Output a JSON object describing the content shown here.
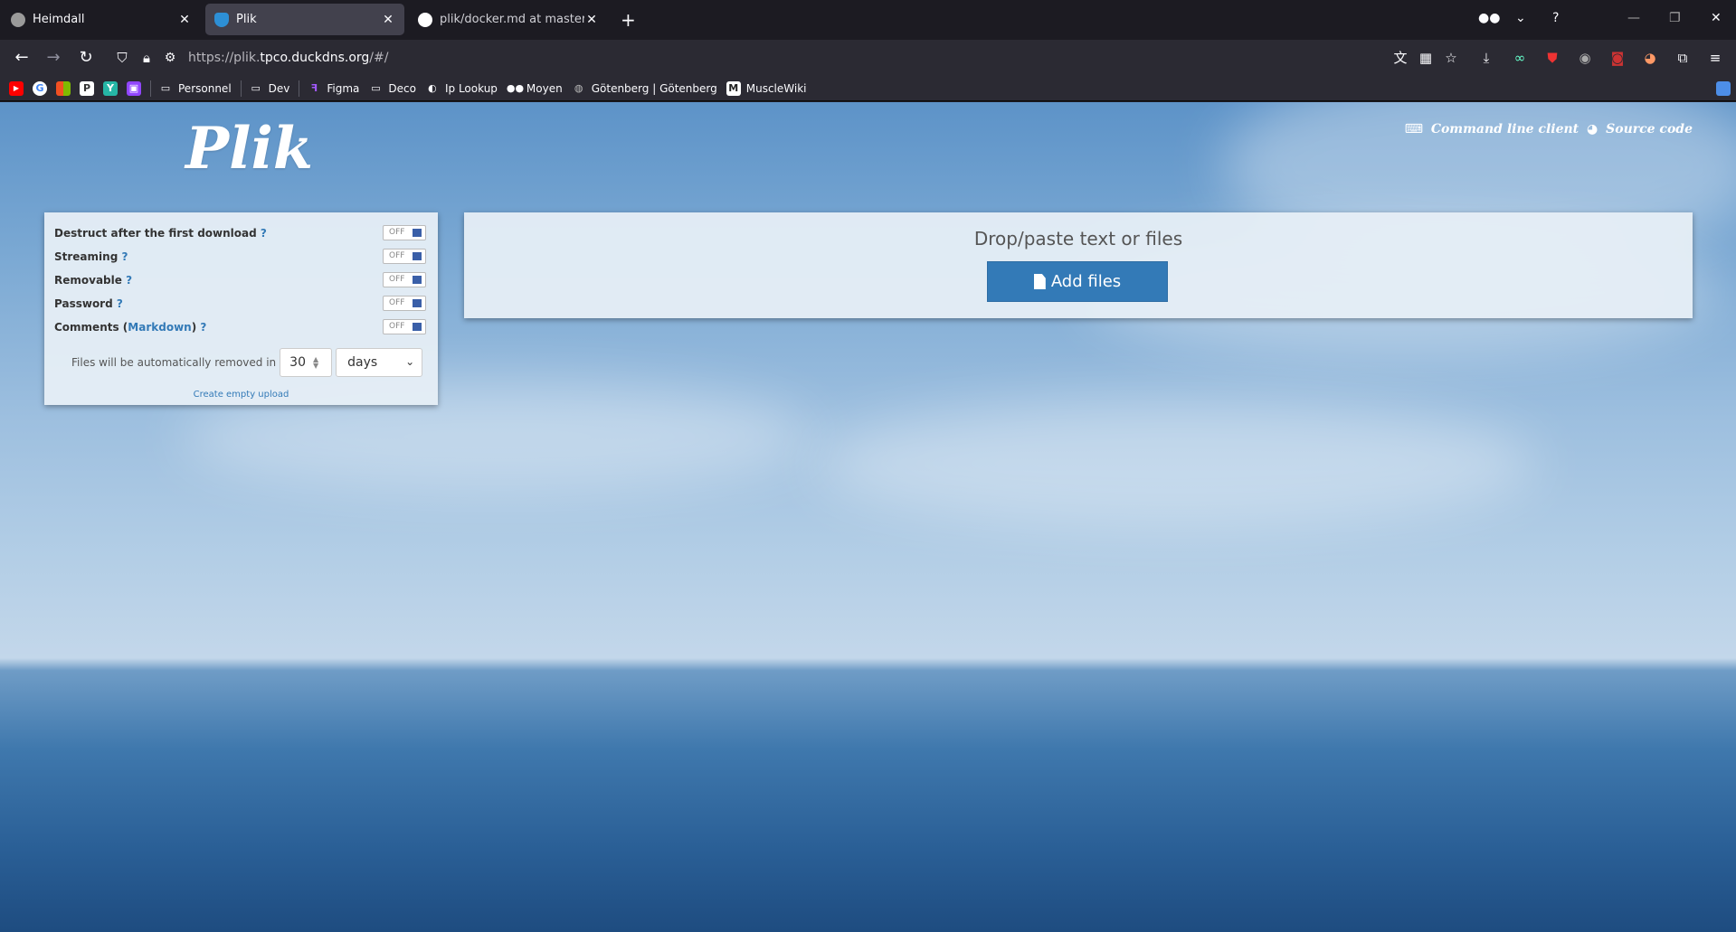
{
  "tabs": [
    {
      "title": "Heimdall",
      "favicon_color": "#9a9a9a",
      "active": false
    },
    {
      "title": "Plik",
      "favicon_color": "#2d8fd5",
      "active": true
    },
    {
      "title": "plik/docker.md at master · root",
      "favicon_color": "#ffffff",
      "active": false
    }
  ],
  "toolbar": {
    "url_prefix": "https://plik.",
    "url_host": "tpco.duckdns.org",
    "url_suffix": "/#/"
  },
  "bookmarks": [
    {
      "label": "",
      "icon": "youtube-icon",
      "color": "#ff0000"
    },
    {
      "label": "",
      "icon": "google-icon",
      "color": "#ffffff"
    },
    {
      "label": "",
      "icon": "microsoft-icon",
      "color": "#f25022"
    },
    {
      "label": "",
      "icon": "p-icon",
      "color": "#ffffff"
    },
    {
      "label": "",
      "icon": "y-icon",
      "color": "#26b6a6"
    },
    {
      "label": "",
      "icon": "twitch-icon",
      "color": "#9146ff"
    },
    {
      "label": "Personnel",
      "icon": "folder-icon"
    },
    {
      "label": "Dev",
      "icon": "folder-icon"
    },
    {
      "label": "Figma",
      "icon": "figma-icon"
    },
    {
      "label": "Deco",
      "icon": "folder-icon"
    },
    {
      "label": "Ip Lookup",
      "icon": "ip-icon"
    },
    {
      "label": "Moyen",
      "icon": "medium-icon"
    },
    {
      "label": "Götenberg | Götenberg",
      "icon": "gotenberg-icon"
    },
    {
      "label": "MuscleWiki",
      "icon": "musclewiki-icon"
    }
  ],
  "app": {
    "logo": "Plik",
    "links": {
      "cli": "Command line client",
      "source": "Source code"
    },
    "drop_title": "Drop/paste text or files",
    "add_files": "Add files"
  },
  "settings": {
    "options": [
      {
        "label": "Destruct after the first download",
        "state": "OFF"
      },
      {
        "label": "Streaming",
        "state": "OFF"
      },
      {
        "label": "Removable",
        "state": "OFF"
      },
      {
        "label": "Password",
        "state": "OFF"
      },
      {
        "label": "Comments",
        "state": "OFF"
      }
    ],
    "markdown_link": "Markdown",
    "help": "?",
    "ttl_text": "Files will be automatically removed in",
    "ttl_value": "30",
    "ttl_unit": "days",
    "empty_upload": "Create empty upload"
  },
  "colors": {
    "accent": "#337ab7",
    "browser_bg": "#1c1b22",
    "toolbar_bg": "#2b2a33"
  }
}
